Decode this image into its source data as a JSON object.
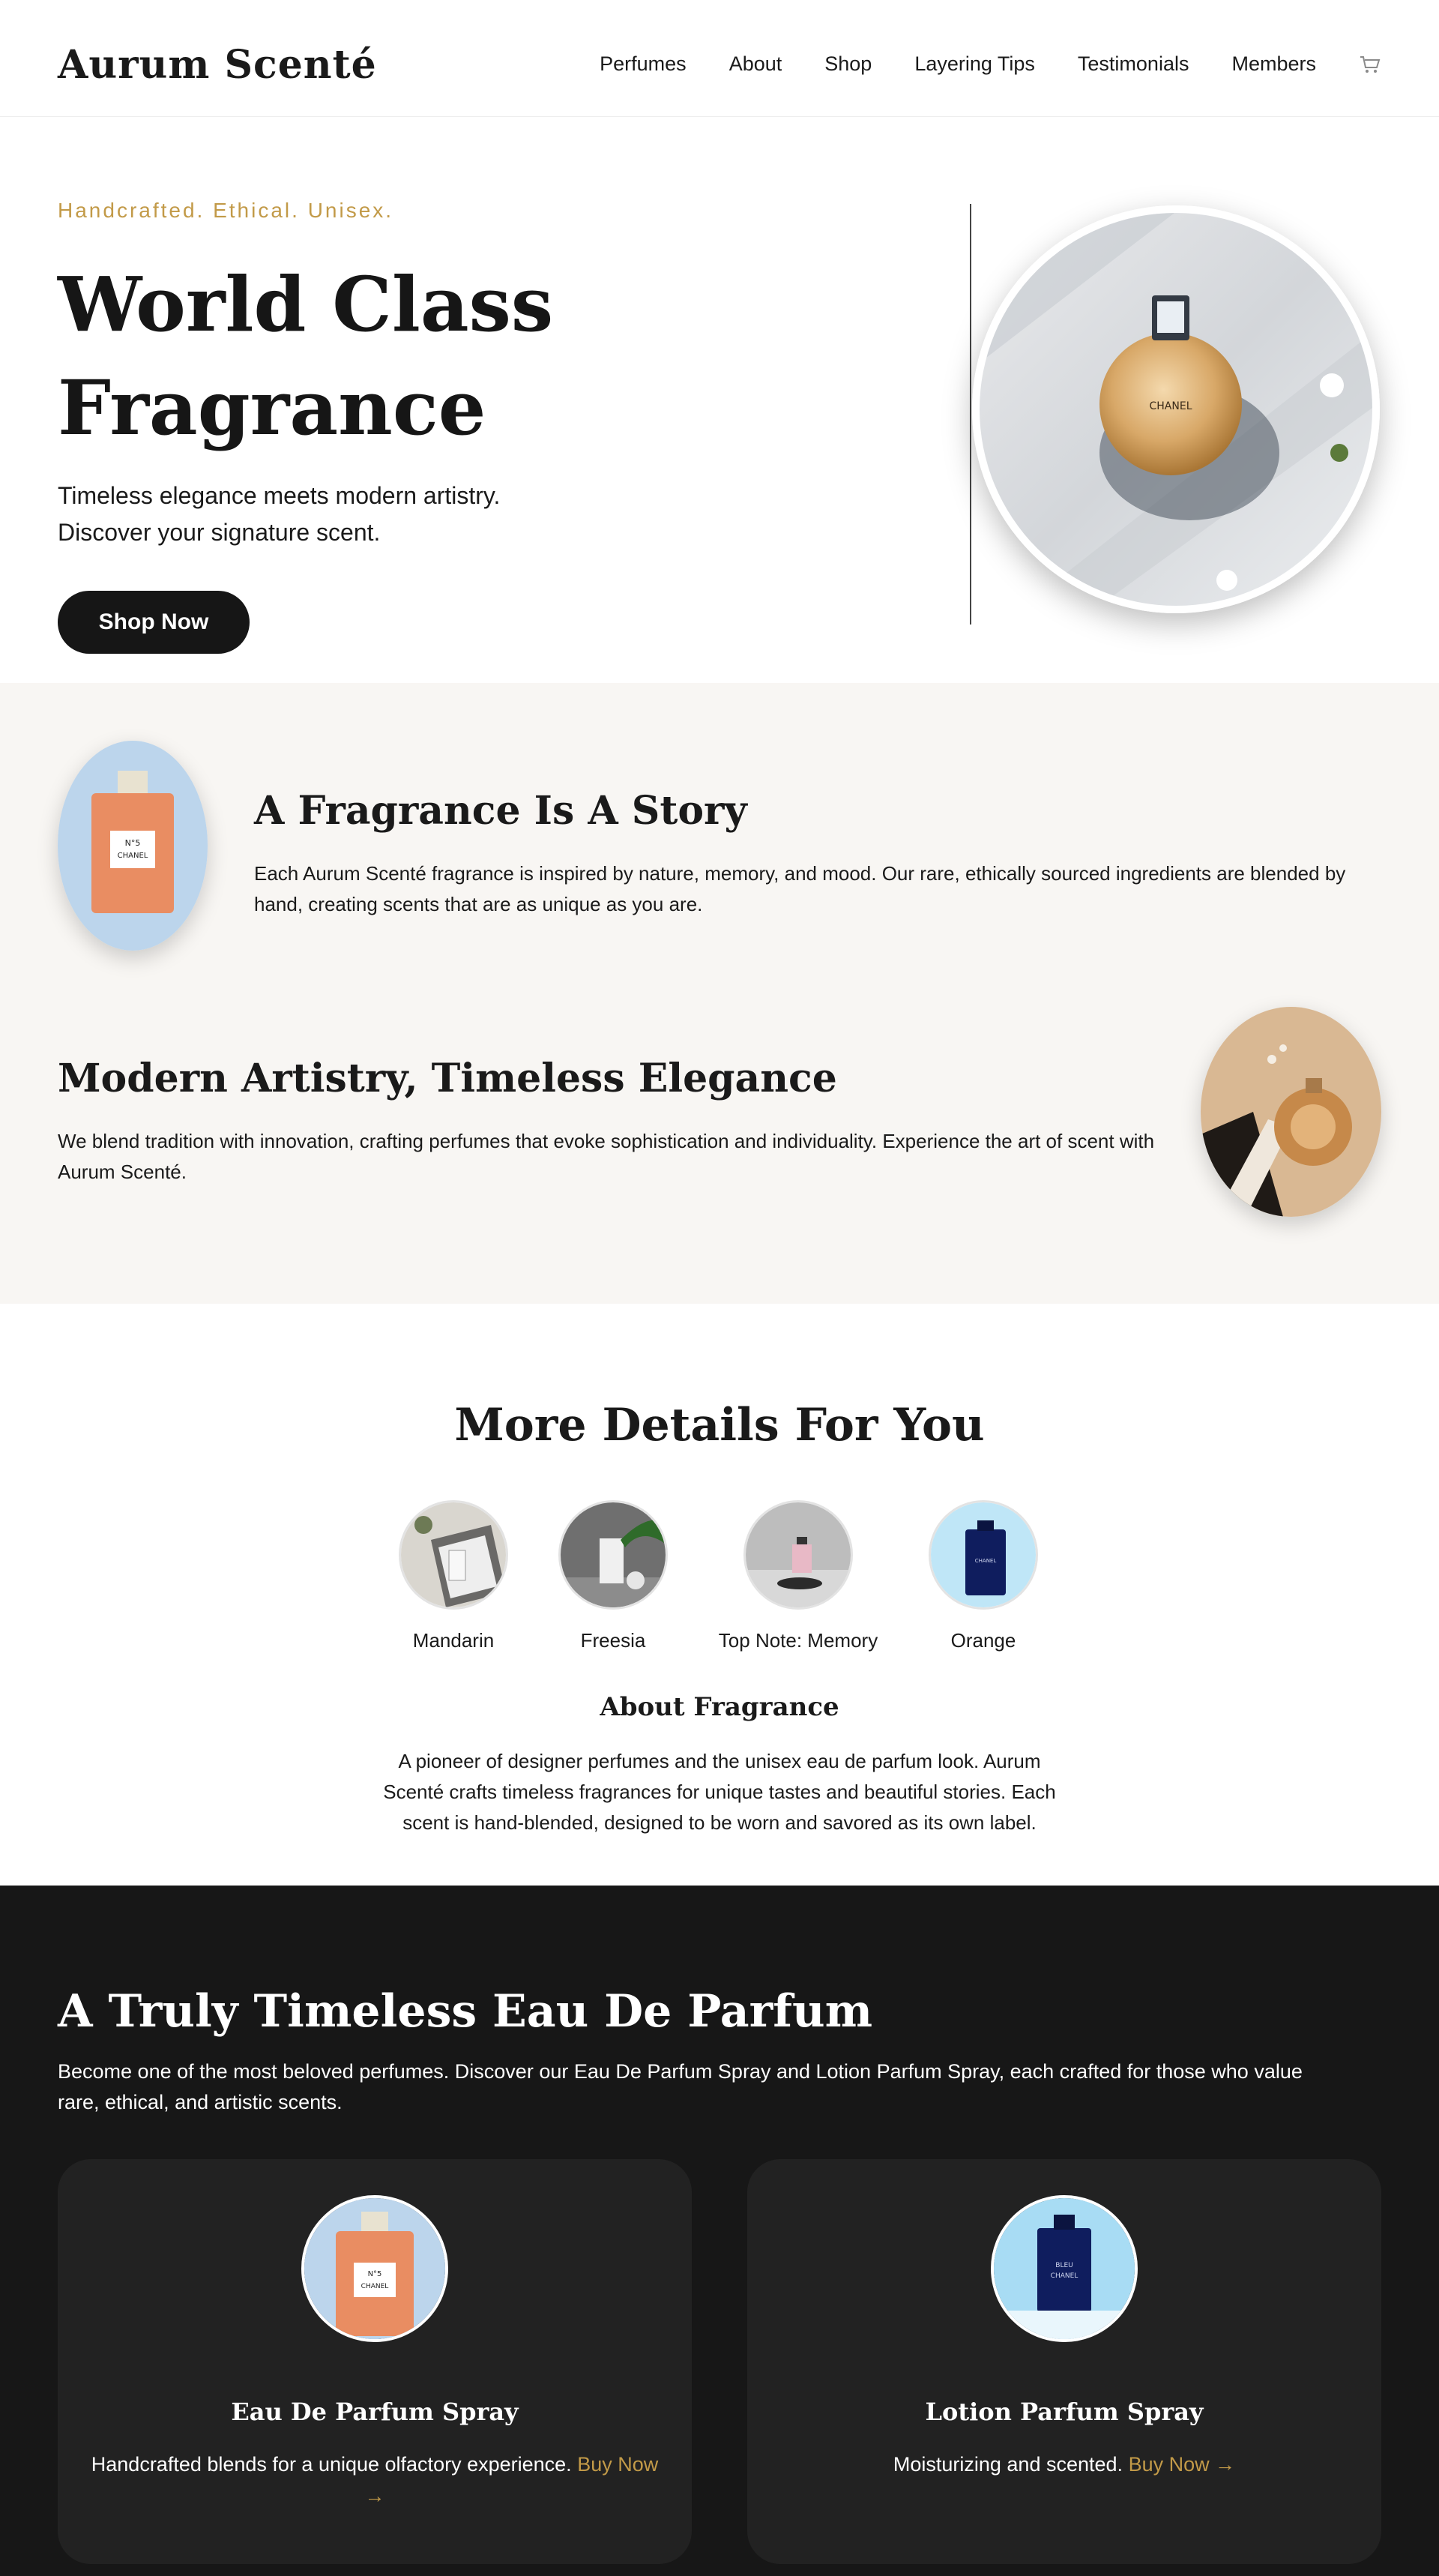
{
  "header": {
    "brand": "Aurum Scenté",
    "nav": [
      "Perfumes",
      "About",
      "Shop",
      "Layering Tips",
      "Testimonials",
      "Members"
    ],
    "cart_icon": "cart-icon"
  },
  "hero": {
    "eyebrow": "Handcrafted. Ethical. Unisex.",
    "title_line1": "World Class",
    "title_line2": "Fragrance",
    "subtitle_line1": "Timeless elegance meets modern artistry.",
    "subtitle_line2": "Discover your signature scent.",
    "cta": "Shop Now"
  },
  "story": {
    "block1": {
      "title": "A Fragrance Is A Story",
      "body": "Each Aurum Scenté fragrance is inspired by nature, memory, and mood. Our rare, ethically sourced ingredients are blended by hand, creating scents that are as unique as you are."
    },
    "block2": {
      "title": "Modern Artistry, Timeless Elegance",
      "body": "We blend tradition with innovation, crafting perfumes that evoke sophistication and individuality. Experience the art of scent with Aurum Scenté."
    }
  },
  "details": {
    "title": "More Details For You",
    "notes": [
      "Mandarin",
      "Freesia",
      "Top Note: Memory",
      "Orange"
    ],
    "about_title": "About Fragrance",
    "about_body": "A pioneer of designer perfumes and the unisex eau de parfum look. Aurum Scenté crafts timeless fragrances for unique tastes and beautiful stories. Each scent is hand-blended, designed to be worn and savored as its own label."
  },
  "products": {
    "title": "A Truly Timeless Eau De Parfum",
    "lead": "Become one of the most beloved perfumes. Discover our Eau De Parfum Spray and Lotion Parfum Spray, each crafted for those who value rare, ethical, and artistic scents.",
    "cards": [
      {
        "name": "Eau De Parfum Spray",
        "desc": "Handcrafted blends for a unique olfactory experience.",
        "link": "Buy Now →"
      },
      {
        "name": "Lotion Parfum Spray",
        "desc": "Moisturizing and scented.",
        "link": "Buy Now →"
      }
    ]
  },
  "colors": {
    "accent": "#c29a48",
    "dark": "#171717",
    "card": "#222222",
    "cream": "#f8f6f3"
  }
}
